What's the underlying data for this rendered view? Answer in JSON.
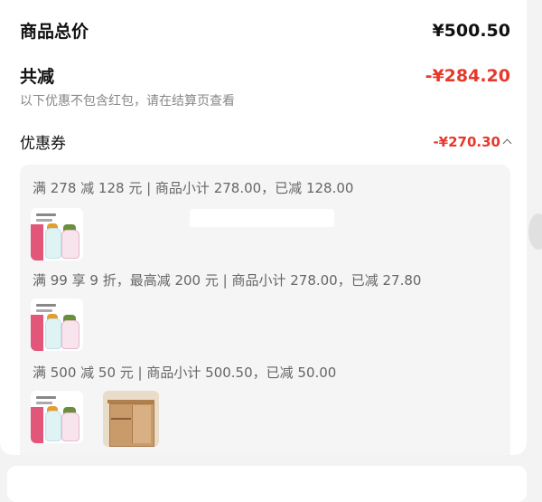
{
  "summary": {
    "total_label": "商品总价",
    "total_value": "¥500.50",
    "discount_label": "共减",
    "discount_value": "-¥284.20",
    "note": "以下优惠不包含红包，请在结算页查看",
    "coupon_label": "优惠券",
    "coupon_value": "-¥270.30"
  },
  "promotions": [
    {
      "text": "满 278 减 128 元 | 商品小计 278.00，已减 128.00",
      "items": [
        "water-bottle"
      ]
    },
    {
      "text": "满 99 享 9 折，最高减 200 元 | 商品小计 278.00，已减 27.80",
      "items": [
        "water-bottle"
      ]
    },
    {
      "text": "满 500 减 50 元 | 商品小计 500.50，已减 50.00",
      "items": [
        "water-bottle",
        "cabinet"
      ]
    }
  ],
  "colors": {
    "accent": "#e8372b",
    "text": "#111111",
    "muted": "#888888"
  },
  "icons": {
    "chevron": "chevron-up-icon"
  }
}
